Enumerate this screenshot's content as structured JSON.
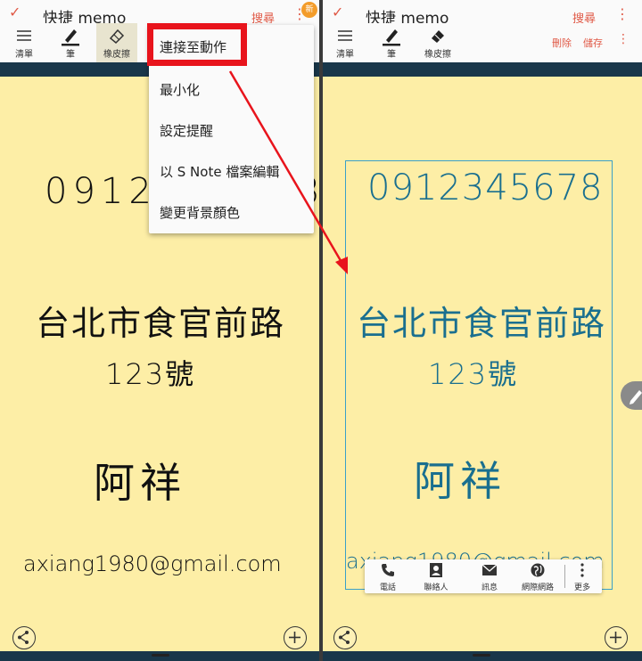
{
  "app": {
    "title": "快捷 memo",
    "search_label": "搜尋",
    "new_badge": "新"
  },
  "toolbar": {
    "list_label": "清單",
    "pen_label": "筆",
    "eraser_label": "橡皮擦",
    "delete_label": "刪除",
    "save_label": "儲存"
  },
  "menu": {
    "items": [
      "連接至動作",
      "最小化",
      "設定提醒",
      "以 S Note 檔案編輯",
      "變更背景顏色"
    ]
  },
  "note": {
    "phone": "0912345678",
    "address_line1": "台北市食官前路",
    "address_line2": "123號",
    "name": "阿祥",
    "email": "axiang1980@gmail.com"
  },
  "action_popup": {
    "items": [
      "電話",
      "聯絡人",
      "訊息",
      "網際網路",
      "更多"
    ]
  },
  "colors": {
    "note_bg": "#fdeea6",
    "accent": "#e05a47",
    "navy": "#19374a",
    "ink_black": "#111111",
    "ink_blue": "#1a6f8f",
    "highlight_red": "#e8141c"
  }
}
